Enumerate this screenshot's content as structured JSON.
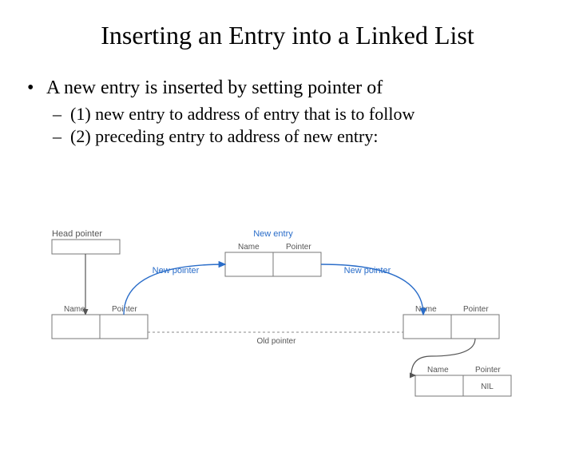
{
  "title": "Inserting an Entry into a Linked List",
  "bullet": {
    "marker": "•",
    "text": "A new entry is inserted by setting pointer of"
  },
  "sub": [
    {
      "marker": "–",
      "text": "(1) new entry to address of entry that is to follow"
    },
    {
      "marker": "–",
      "text": "(2) preceding entry to address of new entry:"
    }
  ],
  "diagram": {
    "head_pointer": "Head pointer",
    "new_entry": "New entry",
    "new_pointer": "New pointer",
    "old_pointer": "Old pointer",
    "name": "Name",
    "pointer": "Pointer",
    "nil": "NIL"
  }
}
